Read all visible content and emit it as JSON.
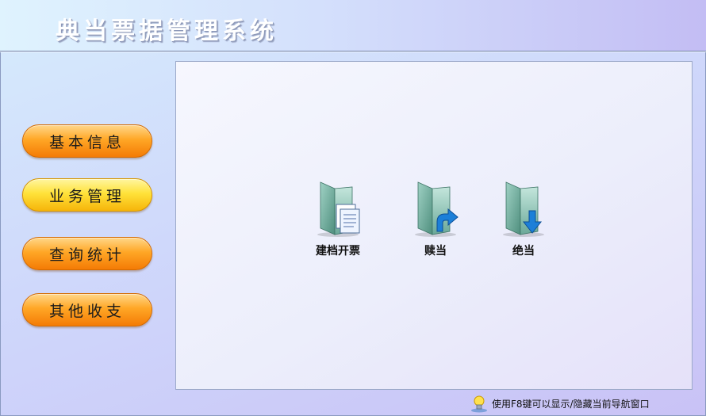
{
  "header": {
    "title": "典当票据管理系统"
  },
  "sidebar": {
    "items": [
      {
        "label": "基本信息"
      },
      {
        "label": "业务管理"
      },
      {
        "label": "查询统计"
      },
      {
        "label": "其他收支"
      }
    ]
  },
  "main": {
    "actions": [
      {
        "label": "建档开票",
        "icon": "folder-document-icon"
      },
      {
        "label": "赎当",
        "icon": "folder-redeem-icon"
      },
      {
        "label": "绝当",
        "icon": "folder-forfeit-icon"
      }
    ]
  },
  "status": {
    "hint": "使用F8键可以显示/隐藏当前导航窗口",
    "icon": "lightbulb-icon"
  },
  "colors": {
    "button_orange": "#f47b05",
    "button_yellow": "#ffe23a",
    "accent_blue": "#1c7fd8"
  }
}
